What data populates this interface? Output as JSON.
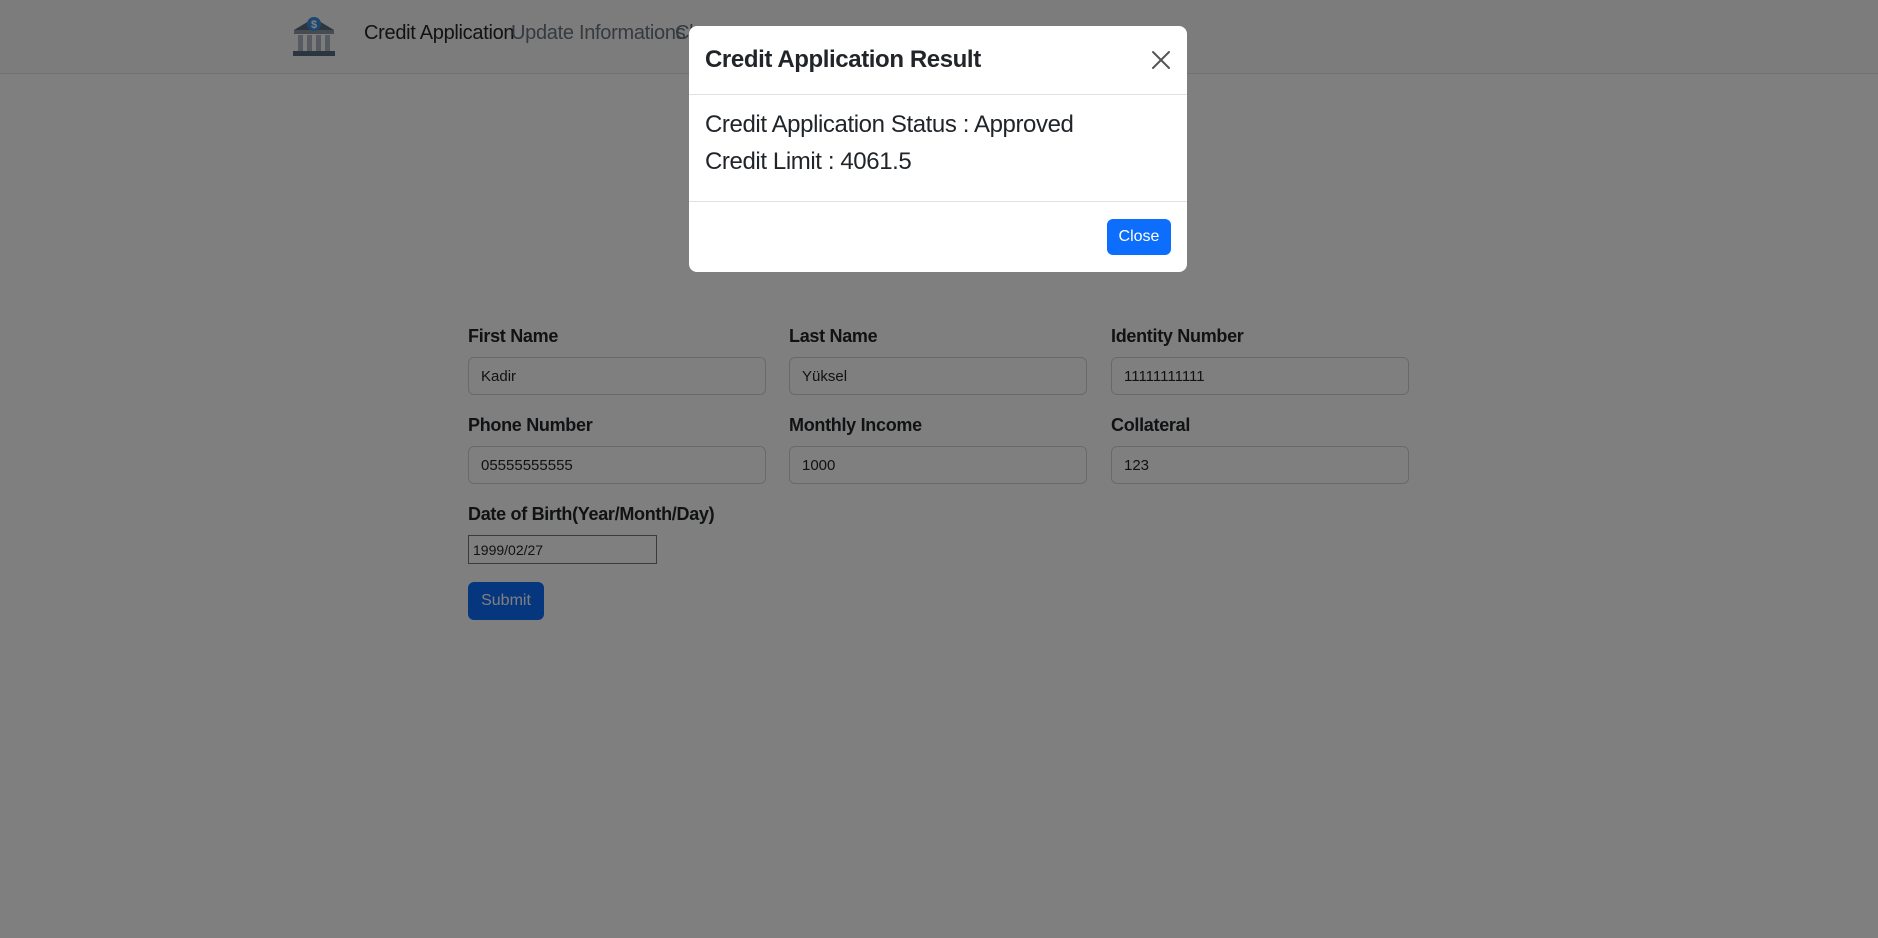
{
  "navbar": {
    "logo_icon": "bank-icon",
    "links": [
      {
        "label": "Credit Application",
        "active": true
      },
      {
        "label": "Update Informations",
        "active": false
      },
      {
        "label": "Cl",
        "active": false
      }
    ]
  },
  "form": {
    "fields": [
      {
        "label": "First Name",
        "value": "Kadir"
      },
      {
        "label": "Last Name",
        "value": "Yüksel"
      },
      {
        "label": "Identity Number",
        "value": "11111111111"
      },
      {
        "label": "Phone Number",
        "value": "05555555555"
      },
      {
        "label": "Monthly Income",
        "value": "1000"
      },
      {
        "label": "Collateral",
        "value": "123"
      }
    ],
    "date_of_birth": {
      "label": "Date of Birth(Year/Month/Day)",
      "value": "1999/02/27"
    },
    "submit_label": "Submit"
  },
  "modal": {
    "title": "Credit Application Result",
    "status_line": "Credit Application Status : Approved",
    "limit_line": "Credit Limit : 4061.5",
    "close_label": "Close"
  },
  "colors": {
    "primary": "#0d6efd",
    "navbar_bg": "#f8f9fa",
    "backdrop": "rgba(0,0,0,0.5)"
  }
}
